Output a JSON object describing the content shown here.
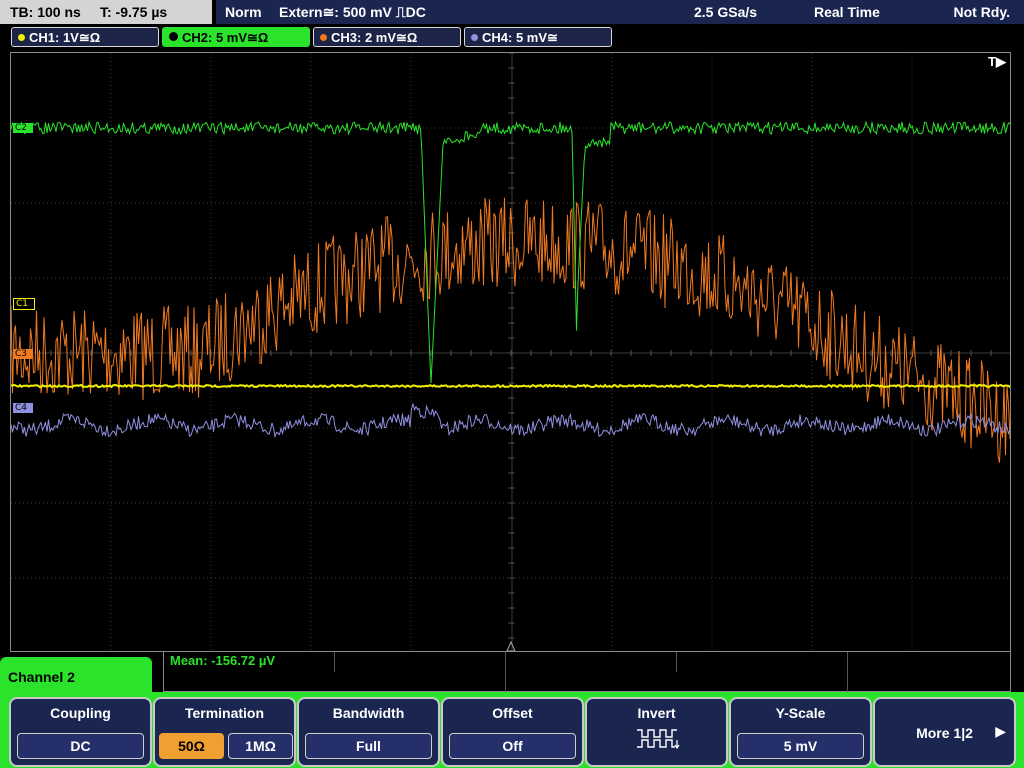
{
  "topbar": {
    "timebase": "TB: 100 ns",
    "trigger_time": "T: -9.75 µs",
    "trigger_mode": "Norm",
    "trigger_source": "Extern≅: 500 mV ⎍DC",
    "sample_rate": "2.5 GSa/s",
    "acq_mode": "Real Time",
    "status": "Not Rdy."
  },
  "channels": [
    {
      "label": "CH1: 1V≅Ω",
      "color": "#f0f000",
      "marker": "C1"
    },
    {
      "label": "CH2: 5 mV≅Ω",
      "color": "#2be32b",
      "marker": "C2"
    },
    {
      "label": "CH3: 2 mV≅Ω",
      "color": "#f07a20",
      "marker": "C3"
    },
    {
      "label": "CH4: 5 mV≅",
      "color": "#9090e0",
      "marker": "C4"
    }
  ],
  "active_channel": "CH2",
  "trigger_flag": "T▶",
  "measurement": {
    "mean": "Mean: -156.72 µV"
  },
  "channel_panel": {
    "title": "Channel 2"
  },
  "softkeys": {
    "coupling": {
      "title": "Coupling",
      "value": "DC"
    },
    "termination": {
      "title": "Termination",
      "options": [
        "50Ω",
        "1MΩ"
      ],
      "selected": "50Ω"
    },
    "bandwidth": {
      "title": "Bandwidth",
      "value": "Full"
    },
    "offset": {
      "title": "Offset",
      "value": "Off"
    },
    "invert": {
      "title": "Invert"
    },
    "yscale": {
      "title": "Y-Scale",
      "value": "5 mV"
    },
    "more": {
      "title": "More 1|2"
    }
  },
  "colors": {
    "accent": "#2be32b",
    "panel": "#1a2650",
    "grid": "#3a3a3a"
  }
}
